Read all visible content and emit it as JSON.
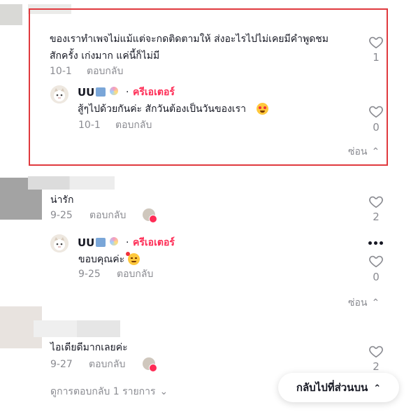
{
  "comments": [
    {
      "text_line1": "ของเราทำเพจไม่แม้แต่จะกดติดตามให้ ส่งอะไรไปไม่เคยมีคำพูดชม",
      "text_line2": "สักครั้ง เก่งมาก แค่นี้ก็ไม่มี",
      "date": "10-1",
      "reply_label": "ตอบกลับ",
      "likes": "1",
      "reply": {
        "username": "UU",
        "badge_text": "ครีเอเตอร์",
        "separator": "·",
        "text": "สู้ๆไปด้วยกันค่ะ สักวันต้องเป็นวันของเรา",
        "date": "10-1",
        "reply_label": "ตอบกลับ",
        "likes": "0"
      },
      "hide_label": "ซ่อน"
    },
    {
      "text": "น่ารัก",
      "date": "9-25",
      "reply_label": "ตอบกลับ",
      "likes": "2",
      "reply": {
        "username": "UU",
        "badge_text": "ครีเอเตอร์",
        "separator": "·",
        "text": "ขอบคุณค่ะ",
        "date": "9-25",
        "reply_label": "ตอบกลับ",
        "likes": "0"
      },
      "hide_label": "ซ่อน"
    },
    {
      "text": "ไอเดียดีมากเลยค่ะ",
      "date": "9-27",
      "reply_label": "ตอบกลับ",
      "likes": "2",
      "view_replies_label": "ดูการตอบกลับ 1 รายการ"
    }
  ],
  "back_to_top_label": "กลับไปที่ส่วนบน",
  "colors": {
    "accent": "#fe2c55",
    "highlight_border": "#e0393e",
    "secondary_text": "#8a8b91"
  }
}
